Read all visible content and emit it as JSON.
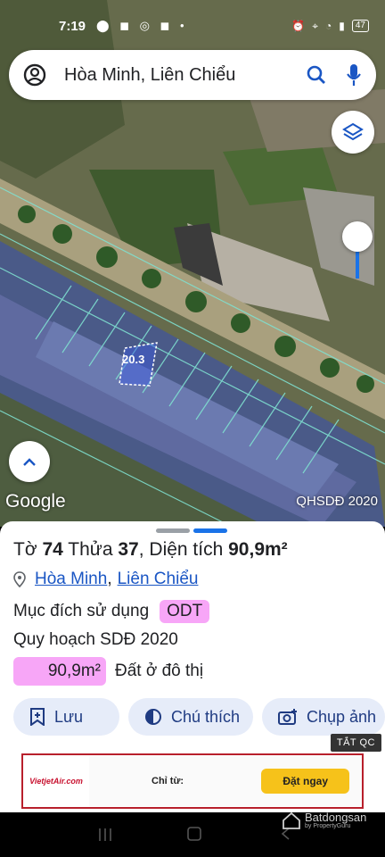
{
  "status_bar": {
    "time": "7:19",
    "battery": "47"
  },
  "search": {
    "query": "Hòa Minh, Liên Chiểu"
  },
  "map": {
    "plot_label": "20.3",
    "brand": "Google",
    "layer_label": "QHSDĐ 2020"
  },
  "parcel": {
    "to_label": "Tờ",
    "to_value": "74",
    "thua_label": "Thửa",
    "thua_value": "37",
    "area_label": "Diện tích",
    "area_value": "90,9m²",
    "ward": "Hòa Minh",
    "district": "Liên Chiểu",
    "purpose_label": "Mục đích sử dụng",
    "purpose_code": "ODT",
    "plan_title": "Quy hoạch SDĐ 2020",
    "plan_area": "90,9m²",
    "plan_name": "Đất ở đô thị"
  },
  "actions": {
    "save": "Lưu",
    "legend": "Chú thích",
    "screenshot": "Chụp ảnh"
  },
  "ads": {
    "close_label": "TẮT QC",
    "brand": "VietjetAir.com",
    "price_label": "Chỉ từ:",
    "cta": "Đặt ngay"
  },
  "watermark": {
    "name": "Batdongsan",
    "sub": "by PropertyGuru"
  },
  "colors": {
    "accent_blue": "#1a73e8",
    "link_blue": "#1a56c4",
    "tag_pink": "#f7a6f7",
    "button_bg": "#e6ecf9",
    "parcel_outline": "#7fe0d0"
  }
}
